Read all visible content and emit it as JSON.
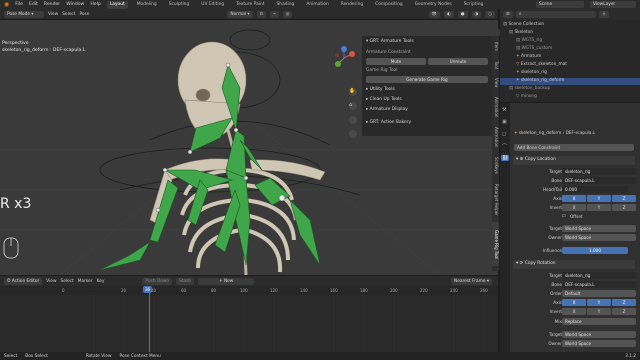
{
  "menu": {
    "items": [
      "File",
      "Edit",
      "Render",
      "Window",
      "Help"
    ],
    "workspaces": [
      "Layout",
      "Modeling",
      "Sculpting",
      "UV Editing",
      "Texture Paint",
      "Shading",
      "Animation",
      "Rendering",
      "Compositing",
      "Geometry Nodes",
      "Scripting"
    ],
    "active_workspace": "Layout",
    "scene_label": "Scene",
    "viewlayer_label": "ViewLayer"
  },
  "viewport_header": {
    "mode": "Pose Mode",
    "menus": [
      "View",
      "Select",
      "Pose"
    ],
    "orientation": "Normal",
    "pose_options": "Pose Options"
  },
  "viewport": {
    "view_name": "Perspective",
    "object_info": "skeleton_rig_deform : DEF-scapula.L",
    "operator_hint": "R x3"
  },
  "npanel": {
    "title": "GRT: Armature Tools",
    "armature_constraint": "Armature Constraint",
    "mute_label": "Mute",
    "unmute_label": "Unmute",
    "game_rig_tool": "Game Rig Tool",
    "generate_label": "Generate Game Rig",
    "sections": [
      "Utility Tools",
      "Clean Up Tools",
      "Armature Display"
    ],
    "bakery": "GRT: Action Bakery"
  },
  "side_tabs": [
    "Item",
    "Tool",
    "View",
    "Animation",
    "Animation",
    "ScriKeys",
    "Retarget Helper",
    "Game Rig Tool"
  ],
  "timeline": {
    "editor": "Action Editor",
    "menus": [
      "View",
      "Select",
      "Marker",
      "Key"
    ],
    "new_label": "New",
    "push_down": "Push Down",
    "stash": "Stash",
    "nearest_frame": "Nearest Frame",
    "ruler": [
      "0",
      "20",
      "40",
      "60",
      "80",
      "100",
      "120",
      "140",
      "160",
      "180",
      "200",
      "220",
      "240",
      "260"
    ],
    "current_frame": 36
  },
  "statusbar": {
    "items": [
      "Select",
      "Box Select",
      "Rotate View",
      "Pose Context Menu"
    ],
    "version": "3.1.2"
  },
  "outliner": {
    "rows": [
      {
        "label": "Scene Collection",
        "indent": 0,
        "selected": false
      },
      {
        "label": "Skeleton",
        "indent": 1,
        "selected": false
      },
      {
        "label": "WGTS_rig",
        "indent": 2,
        "selected": false
      },
      {
        "label": "WGTS_custom",
        "indent": 2,
        "selected": false
      },
      {
        "label": "Armature",
        "indent": 2,
        "selected": false
      },
      {
        "label": "Extract_skeleton_mat",
        "indent": 2,
        "selected": false
      },
      {
        "label": "skeleton_rig",
        "indent": 2,
        "selected": false
      },
      {
        "label": "skeleton_rig_deform",
        "indent": 2,
        "selected": true
      },
      {
        "label": "skeleton_backup",
        "indent": 1,
        "selected": false
      },
      {
        "label": "minong",
        "indent": 2,
        "selected": false
      }
    ]
  },
  "properties": {
    "object_path": "skeleton_rig_deform",
    "bone_path": "DEF-scapula.L",
    "add_constraint": "Add Bone Constraint",
    "copy_location": {
      "title": "Copy Location",
      "target_label": "Target",
      "target": "skeleton_rig",
      "bone_label": "Bone",
      "bone": "DEF-scapula.L",
      "headtail_label": "Head/Tail",
      "headtail": "0.000",
      "axis_label": "Axis",
      "invert_label": "Invert",
      "axes": [
        "X",
        "Y",
        "Z"
      ],
      "offset_label": "Offset",
      "target_space_label": "Target",
      "target_space": "World Space",
      "owner_space_label": "Owner",
      "owner_space": "World Space",
      "influence_label": "Influence",
      "influence": "1.000"
    },
    "copy_rotation": {
      "title": "Copy Rotation",
      "target_label": "Target",
      "target": "skeleton_rig",
      "bone_label": "Bone",
      "bone": "DEF-scapula.L",
      "order_label": "Order",
      "order": "Default",
      "axis_label": "Axis",
      "invert_label": "Invert",
      "axes": [
        "X",
        "Y",
        "Z"
      ],
      "mix_label": "Mix",
      "mix": "Replace",
      "target_space_label": "Target",
      "target_space": "World Space",
      "owner_space_label": "Owner",
      "owner_space": "World Space"
    }
  },
  "colors": {
    "bone_green": "#3fa64a",
    "accent_blue": "#4772b3",
    "bone_ivory": "#cfc6b4"
  }
}
